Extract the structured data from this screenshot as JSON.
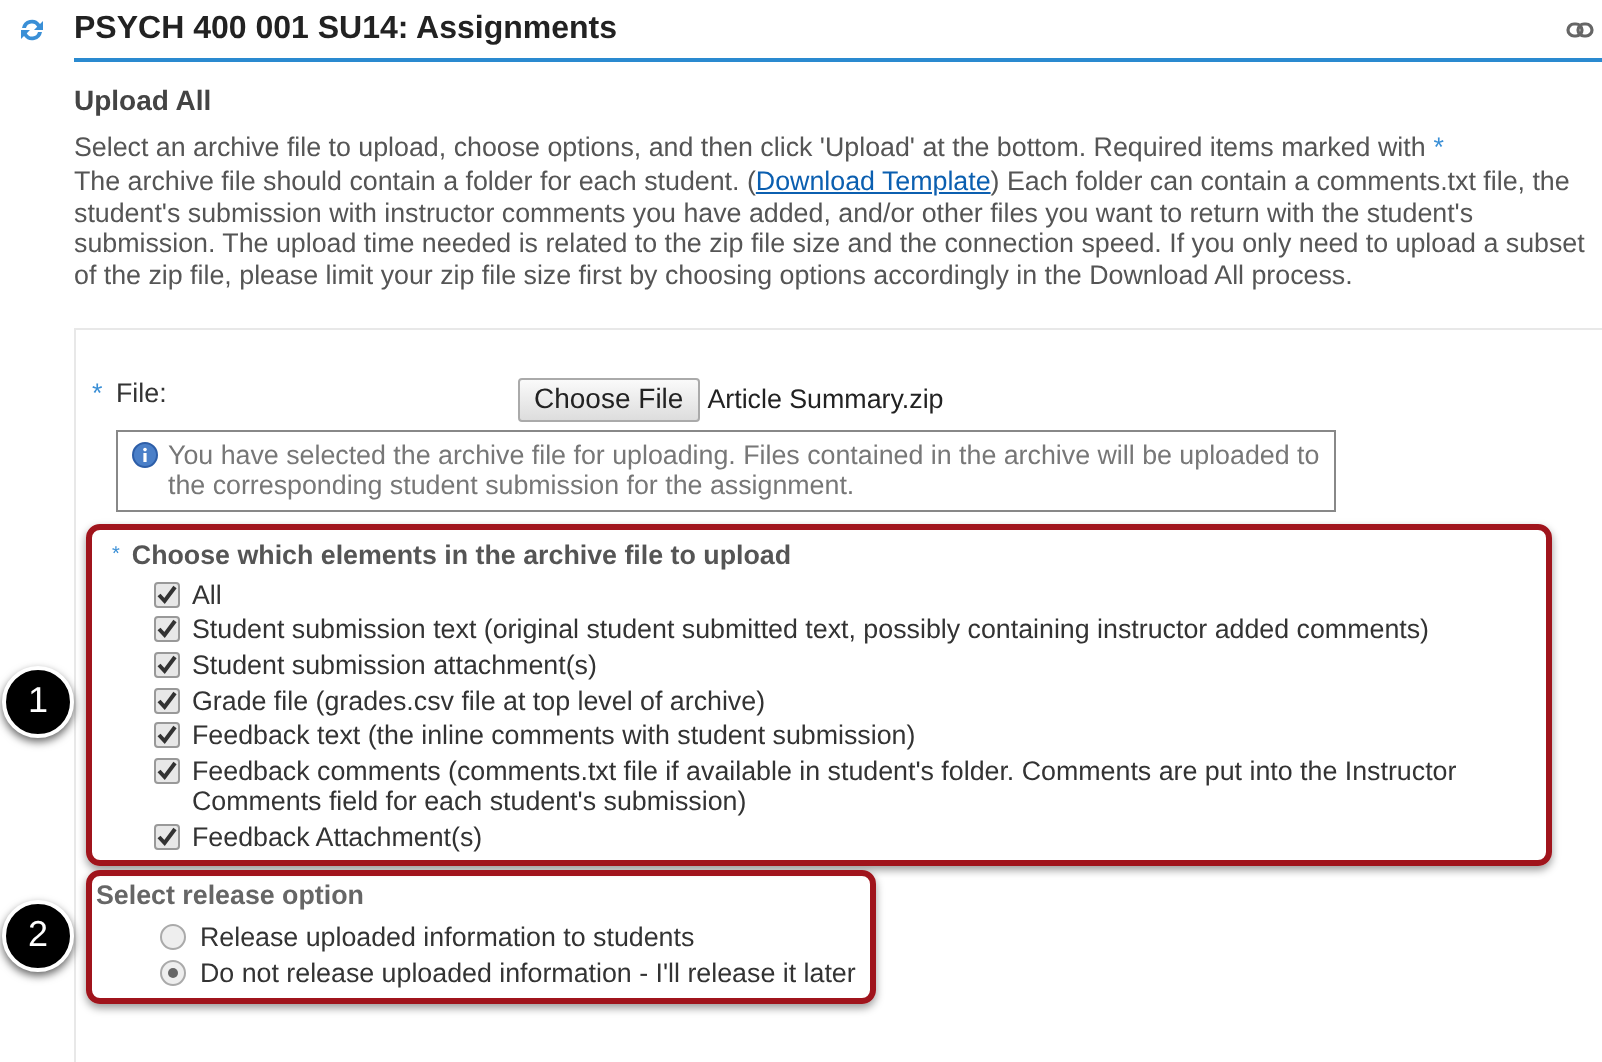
{
  "header": {
    "title": "PSYCH 400 001 SU14: Assignments"
  },
  "section_title": "Upload All",
  "intro": {
    "text": "Select an archive file to upload, choose options, and then click 'Upload' at the bottom. Required items marked with",
    "required_mark": "*"
  },
  "description": {
    "before": "The archive file should contain a folder for each student. (",
    "link": "Download Template",
    "after": ") Each folder can contain a comments.txt file, the student's submission with instructor comments you have added, and/or other files you want to return with the student's submission. The upload time needed is related to the zip file size and the connection speed. If you only need to upload a subset of the zip file, please limit your zip file size first by choosing options accordingly in the Download All process."
  },
  "file_field": {
    "required_mark": "*",
    "label": "File:",
    "button": "Choose File",
    "file_name": "Article Summary.zip"
  },
  "info_message": "You have selected the archive file for uploading. Files contained in the archive will be uploaded to the corresponding student submission for the assignment.",
  "elements_group": {
    "required_mark": "*",
    "title": "Choose which elements in the archive file to upload",
    "callout": "1",
    "options": [
      {
        "label": "All",
        "checked": true
      },
      {
        "label": "Student submission text (original student submitted text, possibly containing instructor added comments)",
        "checked": true
      },
      {
        "label": "Student submission attachment(s)",
        "checked": true
      },
      {
        "label": "Grade file (grades.csv file at top level of archive)",
        "checked": true
      },
      {
        "label": "Feedback text (the inline comments with student submission)",
        "checked": true
      },
      {
        "label": "Feedback comments (comments.txt file if available in student's folder. Comments are put into the Instructor Comments field for each student's submission)",
        "checked": true
      },
      {
        "label": "Feedback Attachment(s)",
        "checked": true
      }
    ]
  },
  "release_group": {
    "title": "Select release option",
    "callout": "2",
    "options": [
      {
        "label": "Release uploaded information to students",
        "selected": false
      },
      {
        "label": "Do not release uploaded information - I'll release it later",
        "selected": true
      }
    ]
  }
}
